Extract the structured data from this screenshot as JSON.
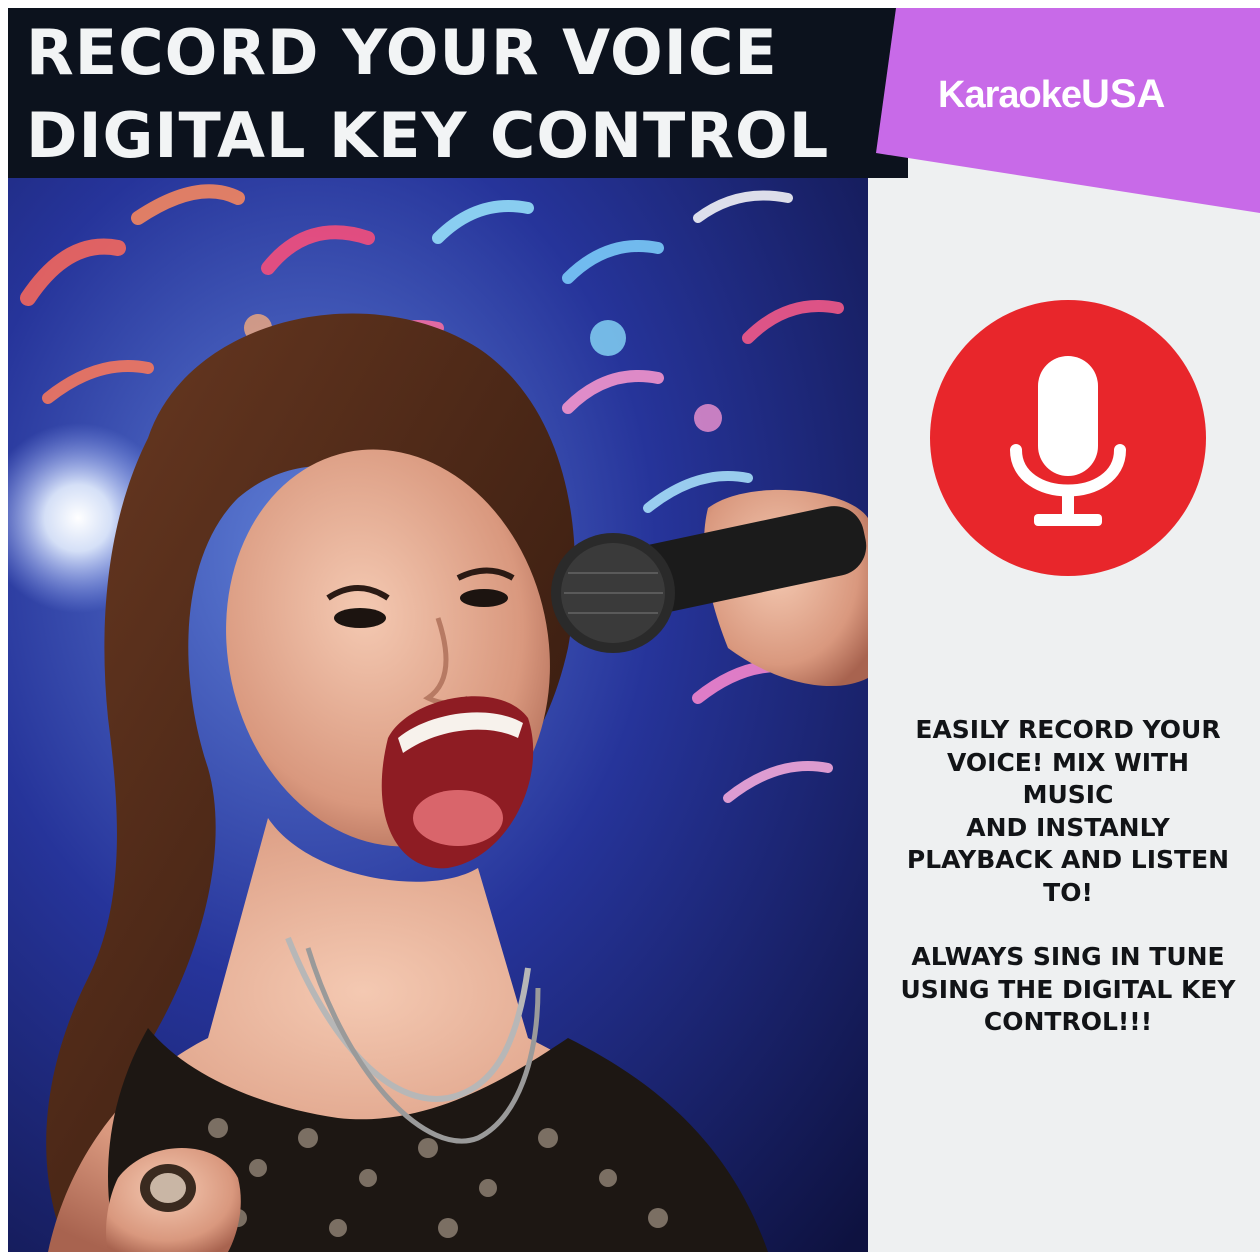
{
  "header": {
    "line1": "RECORD YOUR VOICE",
    "line2": "DIGITAL KEY CONTROL"
  },
  "brand": {
    "name_part1": "Karaoke",
    "name_part2": "USA",
    "band_color": "#c86ae8"
  },
  "photo": {
    "subject": "woman-singing-into-microphone",
    "icon": "stage-lights-bokeh"
  },
  "badge": {
    "icon": "microphone-icon",
    "color": "#e8262b"
  },
  "copy": {
    "paragraph1": [
      "EASILY RECORD YOUR",
      "VOICE! MIX WITH",
      "MUSIC",
      "AND INSTANLY",
      "PLAYBACK AND LISTEN",
      "TO!"
    ],
    "paragraph2": [
      "ALWAYS SING IN TUNE",
      "USING THE DIGITAL KEY",
      "CONTROL!!!"
    ]
  },
  "colors": {
    "header_bg": "#0c121d",
    "panel_bg": "#eef0f1",
    "text_dark": "#121417"
  }
}
